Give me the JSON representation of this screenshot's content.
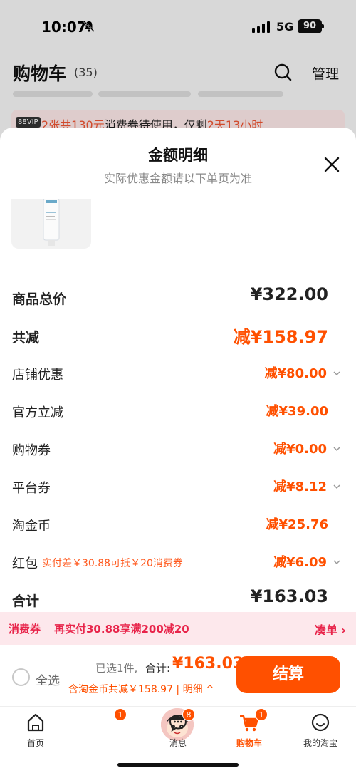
{
  "status_bar": {
    "time": "10:07",
    "network": "5G",
    "battery": "90"
  },
  "cart": {
    "title": "购物车",
    "count": "(35)",
    "manage_label": "管理",
    "coupon_banner": {
      "vip_tag": "88VIP",
      "text_prefix": "2张共130元",
      "text_middle": "消费券待使用，仅剩",
      "text_highlight": "2天13小时"
    }
  },
  "sheet": {
    "title": "金额明细",
    "subtitle": "实际优惠金额请以下单页为准",
    "rows": [
      {
        "label": "商品总价",
        "value": "¥322.00",
        "bold": true
      },
      {
        "label": "共减",
        "value": "减¥158.97",
        "bold": true
      },
      {
        "label": "店铺优惠",
        "value": "减¥80.00"
      },
      {
        "label": "官方立减",
        "value": "减¥39.00"
      },
      {
        "label": "购物券",
        "value": "减¥0.00"
      },
      {
        "label": "平台券",
        "value": "减¥8.12"
      },
      {
        "label": "淘金币",
        "value": "减¥25.76"
      },
      {
        "label": "红包",
        "note": "实付差￥30.88可抵￥20消费券",
        "value": "减¥6.09"
      },
      {
        "label": "合计",
        "value": "¥163.03",
        "bold": true
      }
    ]
  },
  "promo": {
    "tag": "消费券",
    "text": "再实付30.88享满200减20",
    "action": "凑单 ›"
  },
  "checkout": {
    "select_all": "全选",
    "selected_count": "已选1件,",
    "total_label": "合计:",
    "total_value": "¥163.03",
    "sub_summary": "含淘金币共减￥158.97 | 明细 ^",
    "button": "结算"
  },
  "tabs": [
    {
      "label": "首页"
    },
    {
      "label": "",
      "badge": "1"
    },
    {
      "label": "消息",
      "badge": "8"
    },
    {
      "label": "购物车",
      "badge": "1",
      "active": true
    },
    {
      "label": "我的淘宝"
    }
  ],
  "colors": {
    "accent": "#ff5000",
    "promo": "#e8244a",
    "promo_bg": "#fde8ec"
  }
}
